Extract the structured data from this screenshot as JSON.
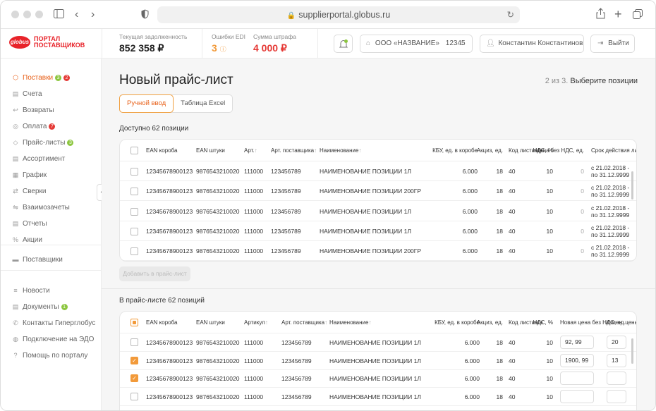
{
  "browser": {
    "url": "supplierportal.globus.ru"
  },
  "logo": {
    "mark": "globus",
    "text": "ПОРТАЛ ПОСТАВЩИКОВ"
  },
  "stats": {
    "debt_label": "Текущая задолженность",
    "debt_value": "852 358 ₽",
    "edi_label": "Ошибки EDI",
    "edi_value": "3",
    "fine_label": "Сумма штрафа",
    "fine_value": "4 000 ₽"
  },
  "header": {
    "company": "ООО «НАЗВАНИЕ»",
    "company_code": "12345",
    "user": "Константин Константинов",
    "logout": "Выйти"
  },
  "sidebar": {
    "items": [
      {
        "label": "Поставки",
        "icon": "box-icon",
        "badges": [
          {
            "text": "3",
            "color": "#8cc63f"
          },
          {
            "text": "2",
            "color": "#e53935"
          }
        ]
      },
      {
        "label": "Счета",
        "icon": "doc-icon"
      },
      {
        "label": "Возвраты",
        "icon": "return-icon"
      },
      {
        "label": "Оплата",
        "icon": "coin-icon",
        "badges": [
          {
            "text": "7",
            "color": "#e53935"
          }
        ]
      },
      {
        "label": "Прайс-листы",
        "icon": "tag-icon",
        "badges": [
          {
            "text": "3",
            "color": "#8cc63f"
          }
        ]
      },
      {
        "label": "Ассортимент",
        "icon": "doc-icon"
      },
      {
        "label": "График",
        "icon": "calendar-icon"
      },
      {
        "label": "Сверки",
        "icon": "swap-icon"
      },
      {
        "label": "Взаимозачеты",
        "icon": "exchange-icon"
      },
      {
        "label": "Отчеты",
        "icon": "doc-icon"
      },
      {
        "label": "Акции",
        "icon": "percent-icon"
      },
      {
        "label": "Поставщики",
        "icon": "truck-icon"
      }
    ],
    "bottom_items": [
      {
        "label": "Новости",
        "icon": "list-icon"
      },
      {
        "label": "Документы",
        "icon": "doc-icon",
        "badges": [
          {
            "text": "1",
            "color": "#8cc63f"
          }
        ]
      },
      {
        "label": "Контакты Гиперглобус",
        "icon": "phone-icon"
      },
      {
        "label": "Подключение на ЭДО",
        "icon": "globe-icon"
      },
      {
        "label": "Помощь по порталу",
        "icon": "help-icon"
      }
    ]
  },
  "page": {
    "title": "Новый прайс-лист",
    "step": "2 из 3.",
    "step_text": "Выберите позиции",
    "tab_manual": "Ручной ввод",
    "tab_excel": "Таблица Excel",
    "available_title": "Доступно 62 позиции",
    "add_button": "Добавить в прайс-лист",
    "in_list_title": "В прайс-листе 62 позиций"
  },
  "table1": {
    "headers": {
      "ean_box": "EAN короба",
      "ean_unit": "EAN штуки",
      "art": "Арт.",
      "supplier_art": "Арт. поставщика",
      "name": "Наименование",
      "kbu": "КБУ, ед. в коробе",
      "excise": "Акциз, ед.",
      "code": "Код листинга",
      "vat": "НДС, %",
      "price": "Цена без НДС, ед.",
      "validity": "Срок действия листинга"
    },
    "rows": [
      {
        "ean_box": "12345678900123",
        "ean_unit": "9876543210020",
        "art": "111000",
        "supplier_art": "123456789",
        "name": "НАИМЕНОВАНИЕ ПОЗИЦИИ 1Л",
        "kbu": "6.000",
        "excise": "18",
        "code": "40",
        "vat": "10",
        "price": "0",
        "validity_from": "с 21.02.2018 -",
        "validity_to": "по 31.12.9999"
      },
      {
        "ean_box": "12345678900123",
        "ean_unit": "9876543210020",
        "art": "111000",
        "supplier_art": "123456789",
        "name": "НАИМЕНОВАНИЕ ПОЗИЦИИ 200ГР",
        "kbu": "6.000",
        "excise": "18",
        "code": "40",
        "vat": "10",
        "price": "0",
        "validity_from": "с 21.02.2018 -",
        "validity_to": "по 31.12.9999"
      },
      {
        "ean_box": "12345678900123",
        "ean_unit": "9876543210020",
        "art": "111000",
        "supplier_art": "123456789",
        "name": "НАИМЕНОВАНИЕ ПОЗИЦИИ 1Л",
        "kbu": "6.000",
        "excise": "18",
        "code": "40",
        "vat": "10",
        "price": "0",
        "validity_from": "с 21.02.2018 -",
        "validity_to": "по 31.12.9999"
      },
      {
        "ean_box": "12345678900123",
        "ean_unit": "9876543210020",
        "art": "111000",
        "supplier_art": "123456789",
        "name": "НАИМЕНОВАНИЕ ПОЗИЦИИ 1Л",
        "kbu": "6.000",
        "excise": "18",
        "code": "40",
        "vat": "10",
        "price": "0",
        "validity_from": "с 21.02.2018 -",
        "validity_to": "по 31.12.9999"
      },
      {
        "ean_box": "12345678900123",
        "ean_unit": "9876543210020",
        "art": "111000",
        "supplier_art": "123456789",
        "name": "НАИМЕНОВАНИЕ ПОЗИЦИИ 200ГР",
        "kbu": "6.000",
        "excise": "18",
        "code": "40",
        "vat": "10",
        "price": "0",
        "validity_from": "с 21.02.2018 -",
        "validity_to": "по 31.12.9999"
      }
    ]
  },
  "table2": {
    "headers": {
      "ean_box": "EAN короба",
      "ean_unit": "EAN штуки",
      "art": "Артикул",
      "supplier_art": "Арт. поставщика",
      "name": "Наименование",
      "kbu": "КБУ, ед. в коробе",
      "excise": "Акциз, ед.",
      "code": "Код листинга",
      "vat": "НДС, %",
      "new_price": "Новая цена без НДС, ед.",
      "change": "Измен. цены, %"
    },
    "rows": [
      {
        "checked": false,
        "ean_box": "12345678900123",
        "ean_unit": "9876543210020",
        "art": "111000",
        "supplier_art": "123456789",
        "name": "НАИМЕНОВАНИЕ ПОЗИЦИИ 1Л",
        "kbu": "6.000",
        "excise": "18",
        "code": "40",
        "vat": "10",
        "new_price": "92, 99",
        "change": "20"
      },
      {
        "checked": true,
        "ean_box": "12345678900123",
        "ean_unit": "9876543210020",
        "art": "111000",
        "supplier_art": "123456789",
        "name": "НАИМЕНОВАНИЕ ПОЗИЦИИ 1Л",
        "kbu": "6.000",
        "excise": "18",
        "code": "40",
        "vat": "10",
        "new_price": "1900, 99",
        "change": "13"
      },
      {
        "checked": true,
        "ean_box": "12345678900123",
        "ean_unit": "9876543210020",
        "art": "111000",
        "supplier_art": "123456789",
        "name": "НАИМЕНОВАНИЕ ПОЗИЦИИ 1Л",
        "kbu": "6.000",
        "excise": "18",
        "code": "40",
        "vat": "10",
        "new_price": "",
        "change": ""
      },
      {
        "checked": false,
        "ean_box": "12345678900123",
        "ean_unit": "9876543210020",
        "art": "111000",
        "supplier_art": "123456789",
        "name": "НАИМЕНОВАНИЕ ПОЗИЦИИ 1Л",
        "kbu": "6.000",
        "excise": "18",
        "code": "40",
        "vat": "10",
        "new_price": "",
        "change": ""
      }
    ]
  },
  "colors": {
    "accent": "#e8611a",
    "brand_red": "#e8232a",
    "green_badge": "#8cc63f",
    "red_badge": "#e53935"
  }
}
